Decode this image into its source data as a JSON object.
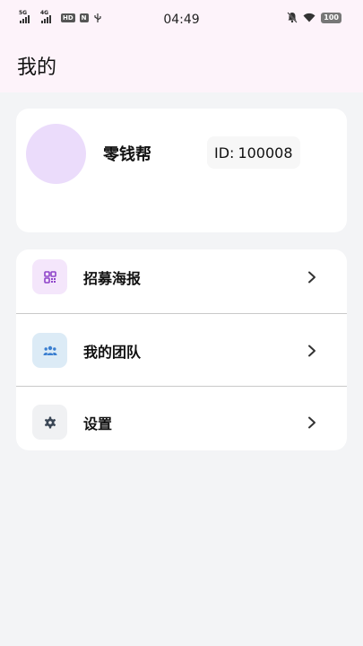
{
  "status_bar": {
    "network_1": "5G",
    "network_2": "4G",
    "hd_badge": "HD",
    "time": "04:49",
    "battery": "100"
  },
  "header": {
    "title": "我的"
  },
  "profile": {
    "nickname": "零钱帮",
    "id_label": "ID:",
    "id_value": "100008"
  },
  "menu": {
    "items": [
      {
        "label": "招募海报",
        "icon": "qr-code-icon",
        "icon_color": "#8e44c9"
      },
      {
        "label": "我的团队",
        "icon": "team-icon",
        "icon_color": "#3b7fd0"
      },
      {
        "label": "设置",
        "icon": "gear-icon",
        "icon_color": "#3a4655"
      }
    ]
  },
  "colors": {
    "header_bg": "#fdf3fa",
    "page_bg": "#f3f4f6",
    "avatar_bg": "#ebdcfb"
  }
}
